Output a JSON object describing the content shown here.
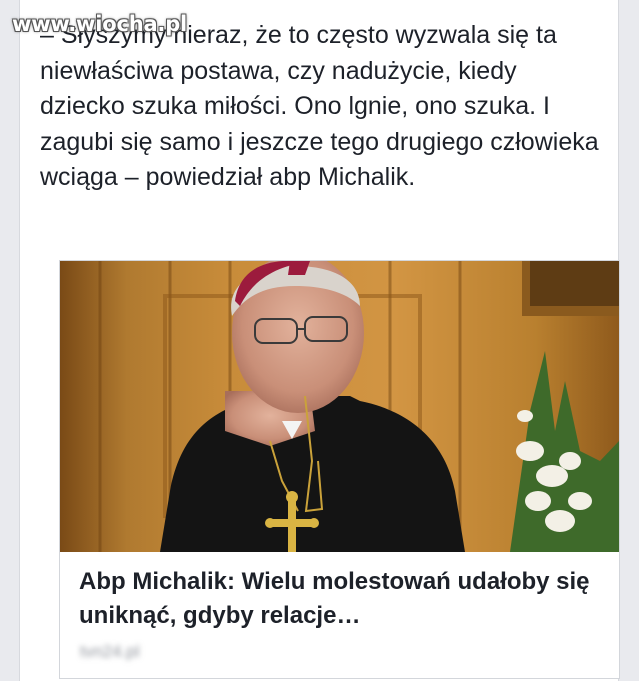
{
  "watermark": "www.wiocha.pl",
  "post": {
    "text": "– Słyszymy nieraz, że to często wyzwala się ta niewłaściwa postawa, czy nadużycie, kiedy dziecko szuka miłości. Ono lgnie, ono szuka. I zagubi się samo i jeszcze tego drugiego człowieka wciąga – powiedział abp Michalik."
  },
  "link_preview": {
    "title": "Abp Michalik: Wielu molestowań udałoby się uniknąć, gdyby relacje…",
    "source": "tvn24.pl"
  },
  "colors": {
    "page_background": "#e9eaee",
    "card_background": "#ffffff",
    "text": "#1d2129",
    "muted_text": "#90949c"
  }
}
